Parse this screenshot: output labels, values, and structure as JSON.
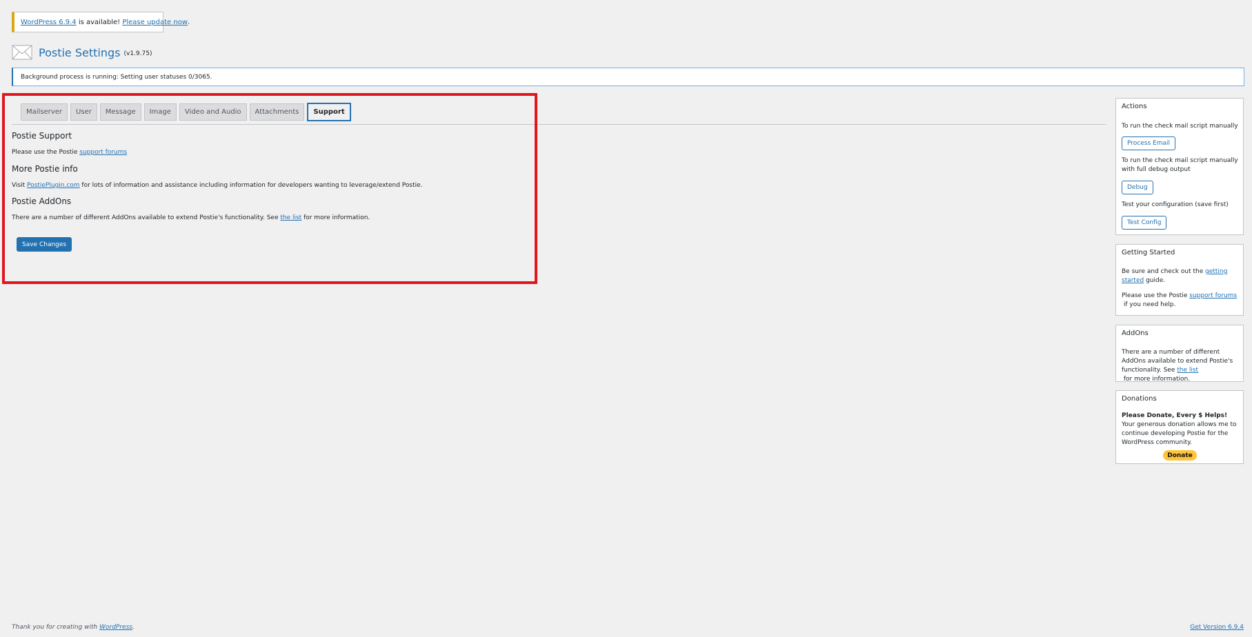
{
  "update_notice": {
    "link_version": "WordPress 6.9.4",
    "middle_text": " is available! ",
    "link_update": "Please update now",
    "end_text": "."
  },
  "header": {
    "title": "Postie Settings",
    "version": "(v1.9.75)"
  },
  "bg_notice": {
    "text": "Background process is running: Setting user statuses 0/3065."
  },
  "tabs": [
    {
      "label": "Mailserver"
    },
    {
      "label": "User"
    },
    {
      "label": "Message"
    },
    {
      "label": "Image"
    },
    {
      "label": "Video and Audio"
    },
    {
      "label": "Attachments"
    },
    {
      "label": "Support"
    }
  ],
  "active_tab": "Support",
  "support": {
    "title": "Postie Support",
    "text_before": "Please use the Postie ",
    "link": "support forums"
  },
  "more_info": {
    "title": "More Postie info",
    "text_before": "Visit ",
    "link": "PostiePlugin.com",
    "text_after": " for lots of information and assistance including information for developers wanting to leverage/extend Postie."
  },
  "addons_main": {
    "title": "Postie AddOns",
    "text_before": "There are a number of different AddOns available to extend Postie's functionality. See ",
    "link": "the list",
    "text_after": " for more information."
  },
  "save_button": "Save Changes",
  "sidebar": {
    "actions": {
      "title": "Actions",
      "process_desc": "To run the check mail script manually",
      "process_btn": "Process Email",
      "debug_desc": "To run the check mail script manually with full debug output",
      "debug_btn": "Debug",
      "test_desc": "Test your configuration (save first)",
      "test_btn": "Test Config"
    },
    "getting_started": {
      "title": "Getting Started",
      "p1_before": "Be sure and check out the ",
      "p1_link": "getting started",
      "p1_after": " guide.",
      "p2_before": "Please use the Postie ",
      "p2_link": "support forums",
      "p2_after": " if you need help."
    },
    "addons": {
      "title": "AddOns",
      "text_before": "There are a number of different AddOns available to extend Postie's functionality. See ",
      "link": "the list",
      "text_after": " for more information."
    },
    "donations": {
      "title": "Donations",
      "heading": "Please Donate, Every $ Helps!",
      "text": "Your generous donation allows me to continue developing Postie for the WordPress community.",
      "button": "Donate"
    }
  },
  "footer": {
    "left_before": "Thank you for creating with ",
    "left_link": "WordPress",
    "left_after": ".",
    "right_link": "Get Version 6.9.4"
  },
  "colors": {
    "accent": "#2271b1",
    "highlight": "#e0161d",
    "donate": "#ffc439"
  }
}
